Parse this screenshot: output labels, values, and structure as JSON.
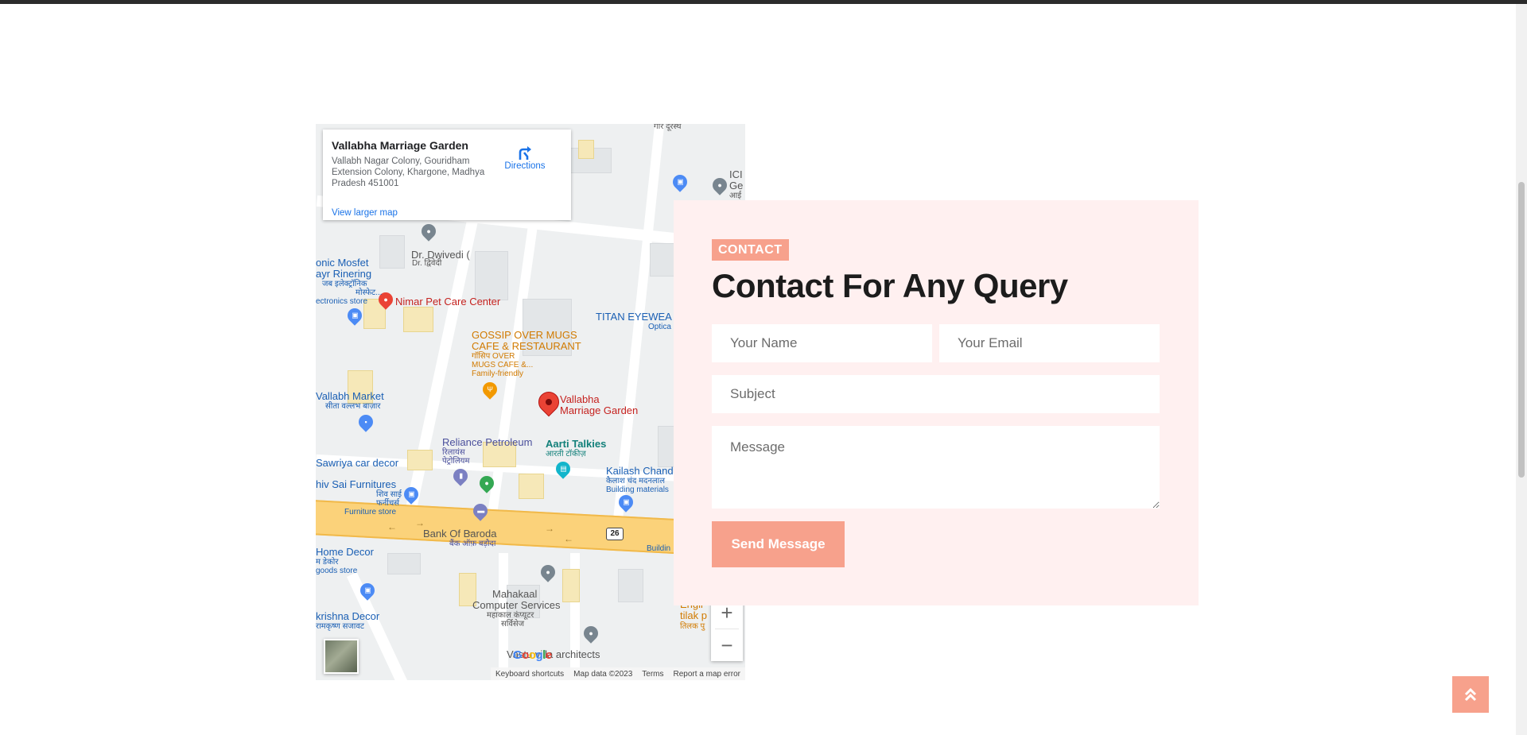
{
  "map": {
    "place_name": "Vallabha Marriage Garden",
    "address": "Vallabh Nagar Colony, Gouridham Extension Colony, Khargone, Madhya Pradesh 451001",
    "directions_label": "Directions",
    "view_larger": "View larger map",
    "zoom_in": "+",
    "zoom_out": "−",
    "footer": {
      "shortcuts": "Keyboard shortcuts",
      "data": "Map data ©2023",
      "terms": "Terms",
      "report": "Report a map error"
    },
    "labels": {
      "dwivedi": "Dr. Dwivedi (",
      "dwivedi_hi": "Dr. द्विवेदी",
      "mosfet1": "onic Mosfet",
      "mosfet2": "ayr Rinering",
      "mosfet3": "जब इलेक्ट्रॉनिक",
      "mosfet4": "मोस्फेट...",
      "electronics": "ectronics store",
      "nimar": "Nimar Pet Care Center",
      "gossip1": "GOSSIP OVER MUGS",
      "gossip2": "CAFE & RESTAURANT",
      "gossip3": "गॉसिप OVER",
      "gossip4": "MUGS CAFE &...",
      "gossip5": "Family-friendly",
      "titan": "TITAN EYEWEA",
      "optical": "Optica",
      "vallabh_market": "Vallabh Market",
      "vallabh_market_hi": "सीता वल्लभ बाज़ार",
      "vallabha1": "Vallabha",
      "vallabha2": "Marriage Garden",
      "reliance": "Reliance Petroleum",
      "reliance_hi1": "रिलायंस",
      "reliance_hi2": "पेट्रोलियम",
      "aarti": "Aarti Talkies",
      "aarti_hi": "आरती टॉकीज़",
      "sawriya": "Sawriya car decor",
      "kailash1": "Kailash Chand",
      "kailash2": "कैलाश चंद मदनलाल",
      "kailash3": "Building materials",
      "shiv1": "hiv Sai Furnitures",
      "shiv2": "शिव साई",
      "shiv3": "फर्नीचर्स",
      "furniture": "Furniture store",
      "bob": "Bank Of Baroda",
      "bob_hi": "बैंक ऑफ़ बड़ौदा",
      "buildin": "Buildin",
      "home_decor1": "Home Decor",
      "home_decor2": "म डेकोर",
      "home_decor3": "goods store",
      "mahakaal1": "Mahakaal",
      "mahakaal2": "Computer Services",
      "mahakaal3": "महाकाल कंप्यूटर",
      "mahakaal4": "सर्विसेज",
      "krishna1": "krishna Decor",
      "krishna2": "रामकृष्ण सजावट",
      "vastu": "Vastu villa architects",
      "tilak1": "Engli",
      "tilak2": "tilak p",
      "tilak3": "तिलक पु",
      "icici1": "ICI",
      "icici2": "Ge",
      "icici3": "आई",
      "top_hi": "गार दूरस्थ",
      "highway_no": "26"
    }
  },
  "contact": {
    "badge": "CONTACT",
    "heading": "Contact For Any Query",
    "name_placeholder": "Your Name",
    "email_placeholder": "Your Email",
    "subject_placeholder": "Subject",
    "message_placeholder": "Message",
    "send_label": "Send Message"
  },
  "colors": {
    "accent": "#f7a18c",
    "card_bg": "#fff0f0",
    "heading": "#1c1c1c"
  },
  "icons": {
    "back_to_top": "double-chevron-up-icon",
    "directions": "directions-icon"
  }
}
